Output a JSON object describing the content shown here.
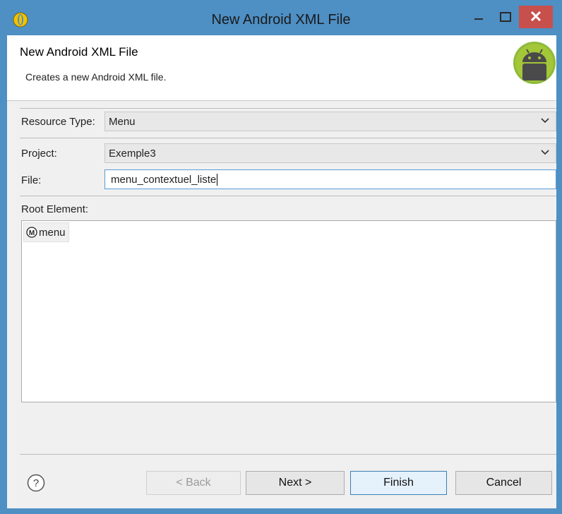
{
  "window": {
    "title": "New Android XML File",
    "controls": {
      "minimize": "—",
      "maximize": "□",
      "close": "✕"
    }
  },
  "header": {
    "title": "New Android XML File",
    "description": "Creates a new Android XML file."
  },
  "form": {
    "resource_type_label": "Resource Type:",
    "resource_type_value": "Menu",
    "project_label": "Project:",
    "project_value": "Exemple3",
    "file_label": "File:",
    "file_value": "menu_contextuel_liste",
    "root_element_label": "Root Element:",
    "root_elements": [
      {
        "icon": "M",
        "label": "menu"
      }
    ]
  },
  "buttons": {
    "help": "?",
    "back": "< Back",
    "next": "Next >",
    "finish": "Finish",
    "cancel": "Cancel"
  },
  "colors": {
    "titlebar": "#4e8fc4",
    "close_button": "#c7504c",
    "dialog_background": "#f0f0f0"
  }
}
